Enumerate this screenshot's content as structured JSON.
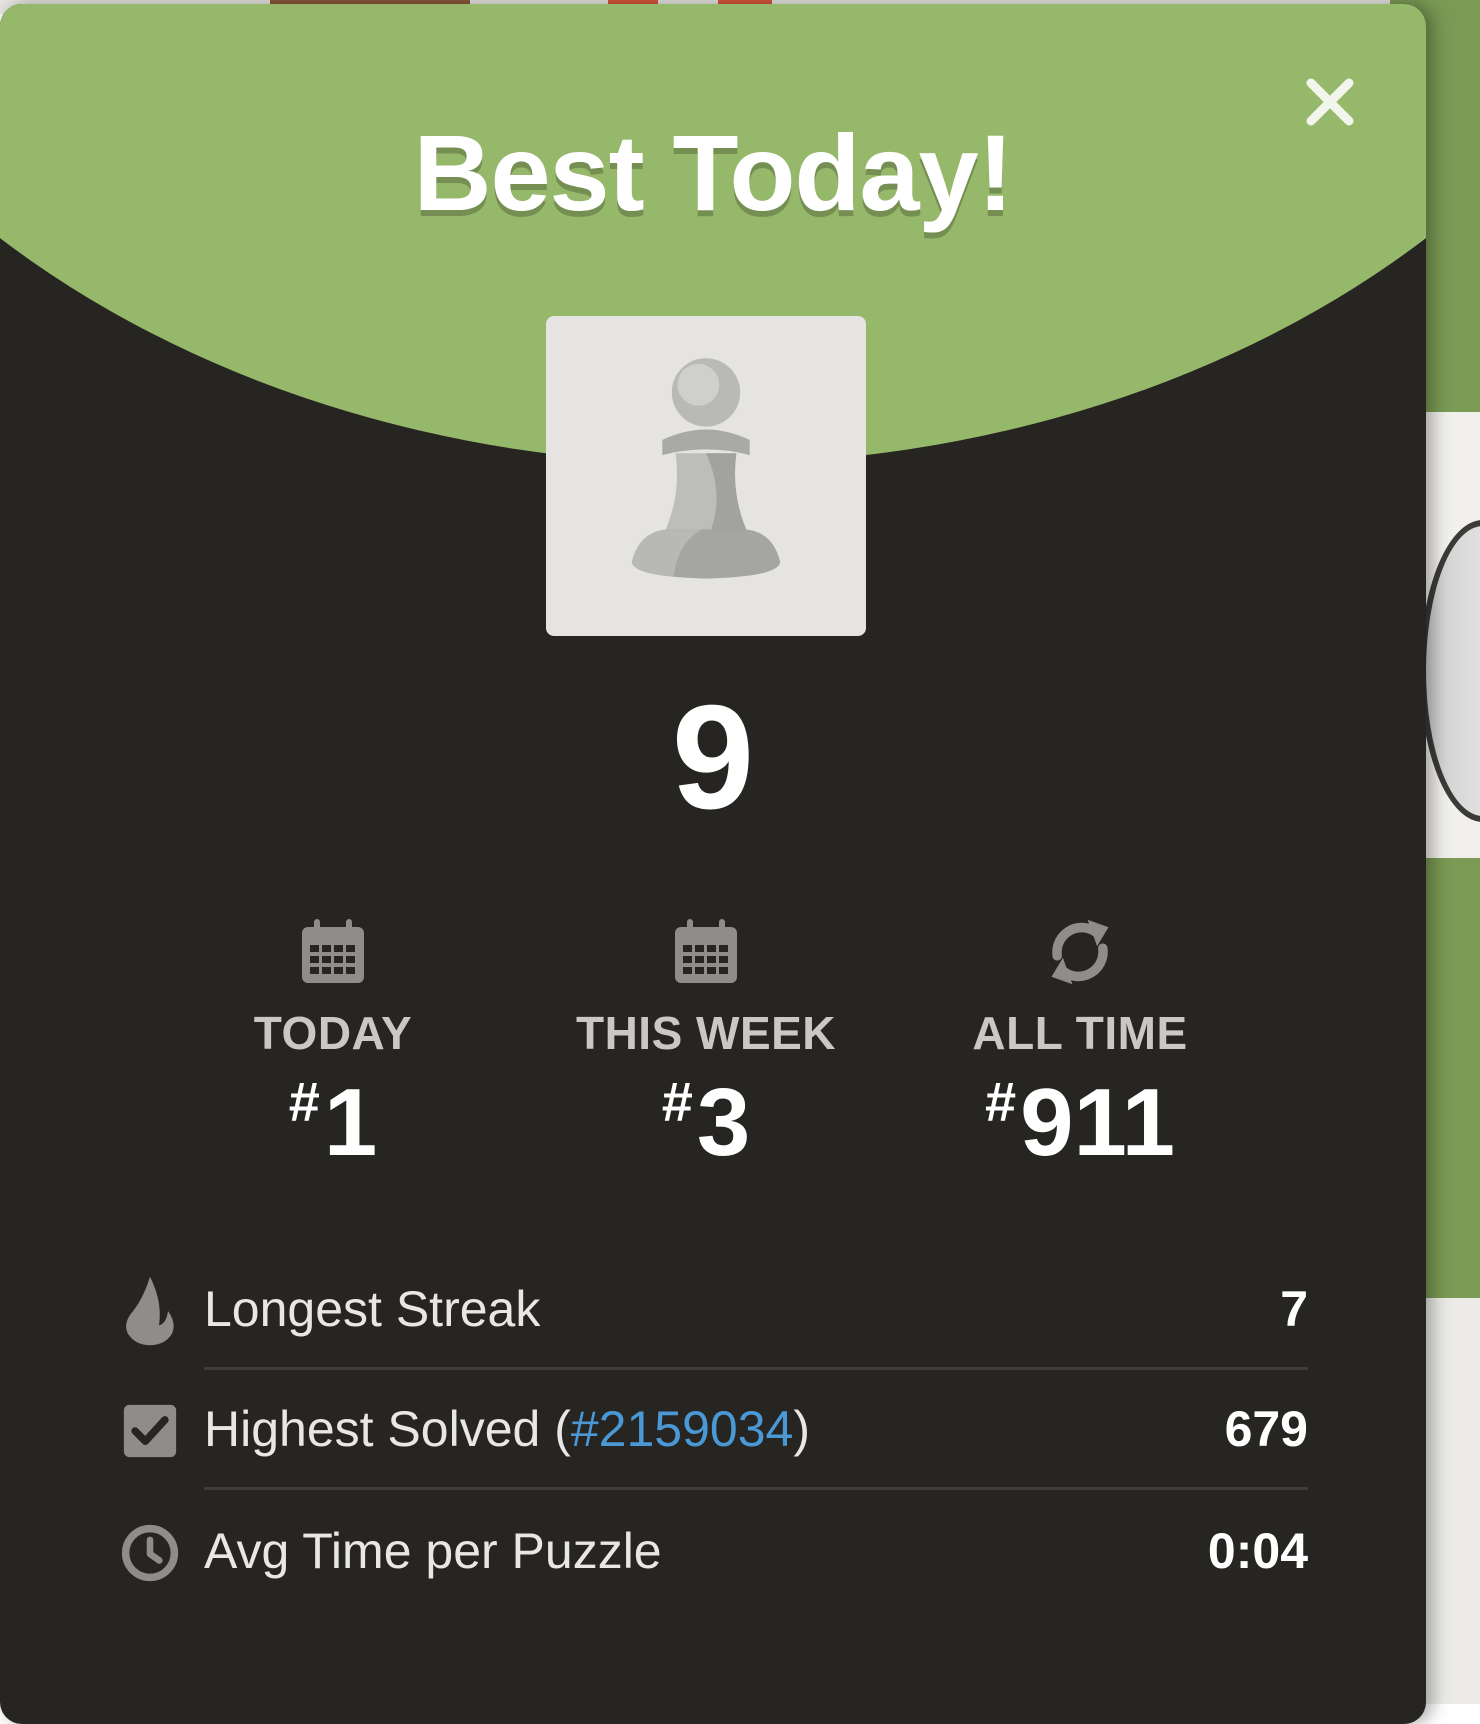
{
  "modal": {
    "title": "Best Today!",
    "close_icon": "close-icon",
    "avatar_icon": "pawn-icon",
    "score": "9"
  },
  "ranks": [
    {
      "icon": "calendar-icon",
      "label": "TODAY",
      "hash": "#",
      "value": "1"
    },
    {
      "icon": "calendar-icon",
      "label": "THIS WEEK",
      "hash": "#",
      "value": "3"
    },
    {
      "icon": "refresh-icon",
      "label": "ALL TIME",
      "hash": "#",
      "value": "911"
    }
  ],
  "stats": {
    "longest_streak": {
      "icon": "flame-icon",
      "label": "Longest Streak",
      "value": "7"
    },
    "highest_solved": {
      "icon": "checkbox-icon",
      "label_prefix": "Highest Solved (",
      "link": "#2159034",
      "label_suffix": ")",
      "value": "679"
    },
    "avg_time": {
      "icon": "clock-icon",
      "label": "Avg Time per Puzzle",
      "value": "0:04"
    }
  },
  "colors": {
    "header_green": "#96b86a",
    "modal_bg": "#262522",
    "link_blue": "#4a98d6"
  }
}
